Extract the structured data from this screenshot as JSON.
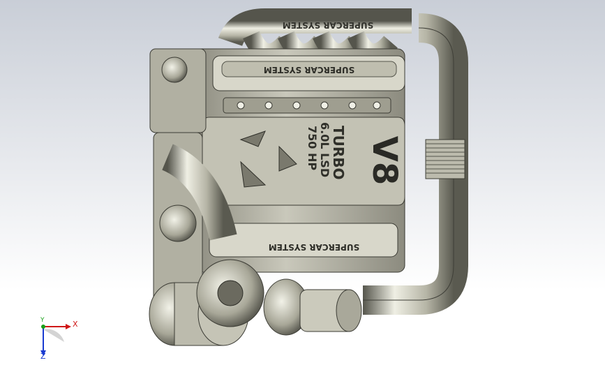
{
  "engine": {
    "manifold_text": "SUPERCAR SYSTEM",
    "valve_cover_text": "SUPERCAR SYSTEM",
    "lower_cover_text": "SUPERCAR SYSTEM",
    "intake_line1": "TURBO",
    "intake_line2": "6.0L LSD",
    "intake_line3": "750 HP",
    "intake_big": "V8"
  },
  "triad": {
    "x": "X",
    "y": "Y",
    "z": "Z"
  },
  "colors": {
    "metal_light": "#e6e6da",
    "metal_mid": "#a9a89a",
    "metal_dark": "#4a4a44",
    "x_axis": "#d01818",
    "y_axis": "#19a019",
    "z_axis": "#1a3bd1"
  }
}
